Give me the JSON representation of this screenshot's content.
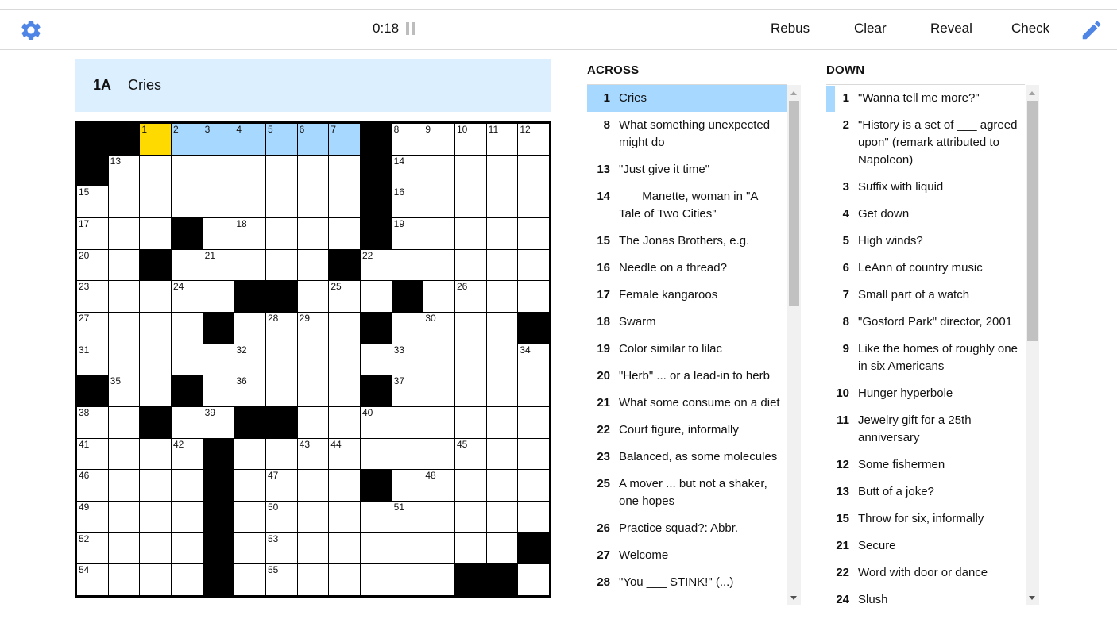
{
  "toolbar": {
    "settings_icon": "gear-icon",
    "timer": "0:18",
    "pause_icon": "pause-icon",
    "buttons": [
      "Rebus",
      "Clear",
      "Reveal",
      "Check"
    ],
    "pencil_icon": "pencil-icon",
    "accent_color": "#4f85e5"
  },
  "current_clue": {
    "label": "1A",
    "text": "Cries"
  },
  "grid": {
    "rows": [
      "###.......#.....",
      "#.........#....."
    ],
    "pattern": [
      "##.......#.....",
      "#........#.....",
      ".........#.....",
      "...#.....#.....",
      "..#.....#......",
      ".....##...#....",
      "....#....#....#",
      "...............",
      "#..#.....#.....",
      "..#..##........",
      "....#.........",
      "....#....#.....",
      "....#..........",
      "....#.........#",
      "....#.......##"
    ],
    "selected_cell": [
      0,
      2
    ],
    "highlighted_cells": [
      [
        0,
        3
      ],
      [
        0,
        4
      ],
      [
        0,
        5
      ],
      [
        0,
        6
      ],
      [
        0,
        7
      ],
      [
        0,
        8
      ]
    ],
    "numbers": [
      [
        0,
        2,
        "1"
      ],
      [
        0,
        3,
        "2"
      ],
      [
        0,
        4,
        "3"
      ],
      [
        0,
        5,
        "4"
      ],
      [
        0,
        6,
        "5"
      ],
      [
        0,
        7,
        "6"
      ],
      [
        0,
        8,
        "7"
      ],
      [
        0,
        10,
        "8"
      ],
      [
        0,
        11,
        "9"
      ],
      [
        0,
        12,
        "10"
      ],
      [
        0,
        13,
        "11"
      ],
      [
        0,
        14,
        "12"
      ],
      [
        1,
        1,
        "13"
      ],
      [
        1,
        10,
        "14"
      ],
      [
        2,
        0,
        "15"
      ],
      [
        2,
        10,
        "16"
      ],
      [
        3,
        0,
        "17"
      ],
      [
        3,
        5,
        "18"
      ],
      [
        3,
        10,
        "19"
      ],
      [
        4,
        0,
        "20"
      ],
      [
        4,
        4,
        "21"
      ],
      [
        4,
        9,
        "22"
      ],
      [
        5,
        0,
        "23"
      ],
      [
        5,
        3,
        "24"
      ],
      [
        5,
        8,
        "25"
      ],
      [
        5,
        12,
        "26"
      ],
      [
        6,
        0,
        "27"
      ],
      [
        6,
        6,
        "28"
      ],
      [
        6,
        7,
        "29"
      ],
      [
        6,
        11,
        "30"
      ],
      [
        7,
        0,
        "31"
      ],
      [
        7,
        5,
        "32"
      ],
      [
        7,
        10,
        "33"
      ],
      [
        7,
        14,
        "34"
      ],
      [
        8,
        1,
        "35"
      ],
      [
        8,
        5,
        "36"
      ],
      [
        8,
        10,
        "37"
      ],
      [
        9,
        0,
        "38"
      ],
      [
        9,
        4,
        "39"
      ],
      [
        9,
        9,
        "40"
      ],
      [
        10,
        0,
        "41"
      ],
      [
        10,
        3,
        "42"
      ],
      [
        10,
        7,
        "43"
      ],
      [
        10,
        8,
        "44"
      ],
      [
        10,
        12,
        "45"
      ],
      [
        11,
        0,
        "46"
      ],
      [
        11,
        6,
        "47"
      ],
      [
        11,
        11,
        "48"
      ],
      [
        12,
        0,
        "49"
      ],
      [
        12,
        6,
        "50"
      ],
      [
        12,
        10,
        "51"
      ],
      [
        13,
        0,
        "52"
      ],
      [
        13,
        6,
        "53"
      ],
      [
        14,
        0,
        "54"
      ],
      [
        14,
        6,
        "55"
      ]
    ]
  },
  "across": {
    "title": "ACROSS",
    "active_index": 0,
    "clues": [
      {
        "n": "1",
        "t": "Cries"
      },
      {
        "n": "8",
        "t": "What something unexpected might do"
      },
      {
        "n": "13",
        "t": "\"Just give it time\""
      },
      {
        "n": "14",
        "t": "___ Manette, woman in \"A Tale of Two Cities\""
      },
      {
        "n": "15",
        "t": "The Jonas Brothers, e.g."
      },
      {
        "n": "16",
        "t": "Needle on a thread?"
      },
      {
        "n": "17",
        "t": "Female kangaroos"
      },
      {
        "n": "18",
        "t": "Swarm"
      },
      {
        "n": "19",
        "t": "Color similar to lilac"
      },
      {
        "n": "20",
        "t": "\"Herb\" ... or a lead-in to herb"
      },
      {
        "n": "21",
        "t": "What some consume on a diet"
      },
      {
        "n": "22",
        "t": "Court figure, informally"
      },
      {
        "n": "23",
        "t": "Balanced, as some molecules"
      },
      {
        "n": "25",
        "t": "A mover ... but not a shaker, one hopes"
      },
      {
        "n": "26",
        "t": "Practice squad?: Abbr."
      },
      {
        "n": "27",
        "t": "Welcome"
      },
      {
        "n": "28",
        "t": "\"You ___ STINK!\" (...)"
      }
    ]
  },
  "down": {
    "title": "DOWN",
    "clues": [
      {
        "n": "1",
        "t": "\"Wanna tell me more?\""
      },
      {
        "n": "2",
        "t": "\"History is a set of ___ agreed upon\" (remark attributed to Napoleon)"
      },
      {
        "n": "3",
        "t": "Suffix with liquid"
      },
      {
        "n": "4",
        "t": "Get down"
      },
      {
        "n": "5",
        "t": "High winds?"
      },
      {
        "n": "6",
        "t": "LeAnn of country music"
      },
      {
        "n": "7",
        "t": "Small part of a watch"
      },
      {
        "n": "8",
        "t": "\"Gosford Park\" director, 2001"
      },
      {
        "n": "9",
        "t": "Like the homes of roughly one in six Americans"
      },
      {
        "n": "10",
        "t": "Hunger hyperbole"
      },
      {
        "n": "11",
        "t": "Jewelry gift for a 25th anniversary"
      },
      {
        "n": "12",
        "t": "Some fishermen"
      },
      {
        "n": "13",
        "t": "Butt of a joke?"
      },
      {
        "n": "15",
        "t": "Throw for six, informally"
      },
      {
        "n": "21",
        "t": "Secure"
      },
      {
        "n": "22",
        "t": "Word with door or dance"
      },
      {
        "n": "24",
        "t": "Slush"
      }
    ]
  }
}
